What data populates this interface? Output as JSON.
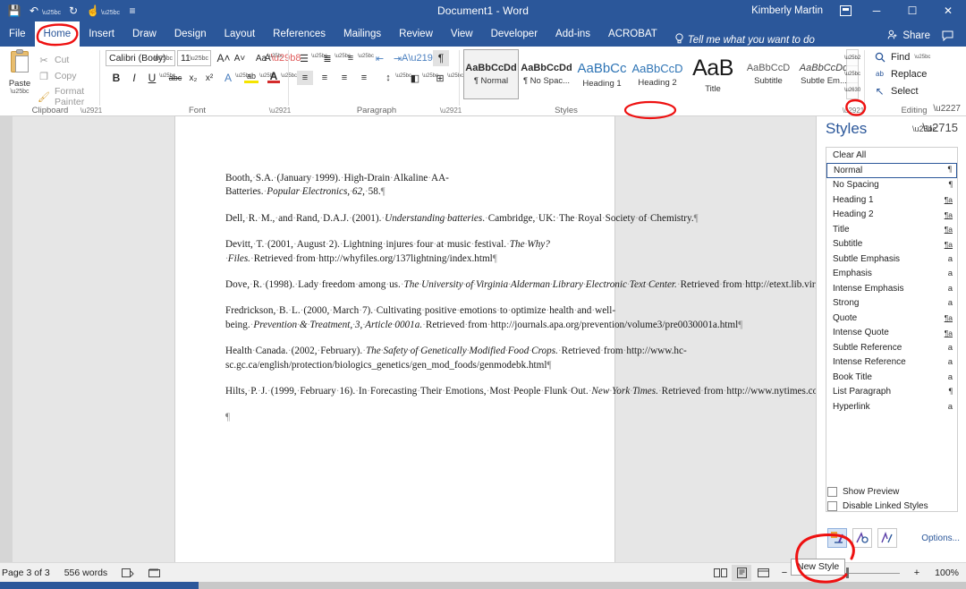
{
  "window": {
    "title": "Document1  -  Word",
    "account": "Kimberly Martin",
    "ribbon_display_icon": "ribbon-display-options-icon",
    "minimize": "─",
    "maximize": "☐",
    "close": "✕"
  },
  "quick_access": [
    {
      "name": "save",
      "glyph": "💾"
    },
    {
      "name": "undo",
      "glyph": "↶"
    },
    {
      "name": "redo",
      "glyph": "↻"
    },
    {
      "name": "touch-mode",
      "glyph": "☝"
    },
    {
      "name": "customize-quick-access-toolbar",
      "glyph": "≡"
    }
  ],
  "tabs": [
    {
      "label": "File",
      "active": false
    },
    {
      "label": "Home",
      "active": true
    },
    {
      "label": "Insert",
      "active": false
    },
    {
      "label": "Draw",
      "active": false
    },
    {
      "label": "Design",
      "active": false
    },
    {
      "label": "Layout",
      "active": false
    },
    {
      "label": "References",
      "active": false
    },
    {
      "label": "Mailings",
      "active": false
    },
    {
      "label": "Review",
      "active": false
    },
    {
      "label": "View",
      "active": false
    },
    {
      "label": "Developer",
      "active": false
    },
    {
      "label": "Add-ins",
      "active": false
    },
    {
      "label": "ACROBAT",
      "active": false
    }
  ],
  "tell_me": {
    "label": "Tell me what you want to do",
    "icon": "lightbulb-icon"
  },
  "share": {
    "label": "Share",
    "icon": "person-share-icon"
  },
  "comments_icon": "comments-icon",
  "ribbon": {
    "clipboard": {
      "label": "Clipboard",
      "paste": "Paste",
      "items": [
        {
          "label": "Cut",
          "icon": "scissors-icon",
          "glyph": "✂"
        },
        {
          "label": "Copy",
          "icon": "copy-icon",
          "glyph": "❐"
        },
        {
          "label": "Format Painter",
          "icon": "format-painter-icon",
          "glyph": "🖌"
        }
      ]
    },
    "font": {
      "label": "Font",
      "font_name": "Calibri (Body)",
      "font_size": "11",
      "row1": [
        {
          "name": "grow-font-icon",
          "glyph": "A˄"
        },
        {
          "name": "shrink-font-icon",
          "glyph": "A˅"
        },
        {
          "name": "change-case-icon",
          "glyph": "Aa"
        },
        {
          "name": "clear-formatting-icon",
          "glyph": "A⌨"
        }
      ],
      "row2": [
        {
          "name": "bold-icon",
          "glyph": "B"
        },
        {
          "name": "italic-icon",
          "glyph": "I"
        },
        {
          "name": "underline-icon",
          "glyph": "U"
        },
        {
          "name": "strikethrough-icon",
          "glyph": "abc"
        },
        {
          "name": "subscript-icon",
          "glyph": "x₂"
        },
        {
          "name": "superscript-icon",
          "glyph": "x²"
        },
        {
          "name": "text-effects-icon",
          "glyph": "A"
        },
        {
          "name": "text-highlight-color-icon",
          "glyph": "ab"
        },
        {
          "name": "font-color-icon",
          "glyph": "A"
        }
      ]
    },
    "paragraph": {
      "label": "Paragraph",
      "row1": [
        {
          "name": "bullets-icon",
          "glyph": "☰"
        },
        {
          "name": "numbering-icon",
          "glyph": "≣"
        },
        {
          "name": "multilevel-list-icon",
          "glyph": "≡"
        },
        {
          "name": "decrease-indent-icon",
          "glyph": "⇤"
        },
        {
          "name": "increase-indent-icon",
          "glyph": "⇥"
        },
        {
          "name": "sort-icon",
          "glyph": "↕"
        },
        {
          "name": "show-hide-formatting-icon",
          "glyph": "¶"
        }
      ],
      "row2": [
        {
          "name": "align-left-icon",
          "glyph": "≡"
        },
        {
          "name": "align-center-icon",
          "glyph": "≡"
        },
        {
          "name": "align-right-icon",
          "glyph": "≡"
        },
        {
          "name": "justify-icon",
          "glyph": "≡"
        },
        {
          "name": "line-spacing-icon",
          "glyph": "↕"
        },
        {
          "name": "shading-icon",
          "glyph": "◧"
        },
        {
          "name": "borders-icon",
          "glyph": "⊞"
        }
      ]
    },
    "styles": {
      "label": "Styles",
      "gallery": [
        {
          "preview": "AaBbCcDd",
          "label": "¶ Normal",
          "kind": "normal",
          "selected": true
        },
        {
          "preview": "AaBbCcDd",
          "label": "¶ No Spac...",
          "kind": "normal",
          "selected": false
        },
        {
          "preview": "AaBbCc",
          "label": "Heading 1",
          "kind": "heading",
          "selected": false
        },
        {
          "preview": "AaBbCcD",
          "label": "Heading 2",
          "kind": "heading",
          "selected": false
        },
        {
          "preview": "AaB",
          "label": "Title",
          "kind": "title",
          "selected": false
        },
        {
          "preview": "AaBbCcD",
          "label": "Subtitle",
          "kind": "subtitle",
          "selected": false
        },
        {
          "preview": "AaBbCcDd",
          "label": "Subtle Em...",
          "kind": "subtle-em",
          "selected": false
        }
      ]
    },
    "editing": {
      "label": "Editing",
      "items": [
        {
          "label": "Find",
          "icon": "search-icon",
          "glyph": "⚲",
          "caret": true
        },
        {
          "label": "Replace",
          "icon": "replace-icon",
          "glyph": "ab",
          "caret": false
        },
        {
          "label": "Select",
          "icon": "select-icon",
          "glyph": "↖",
          "caret": true
        }
      ]
    },
    "collapse_icon": "collapse-ribbon-icon"
  },
  "document": {
    "paragraphs": [
      "Booth, S.A. (January 1999). High-Drain Alkaline AA-Batteries. <i>Popular Electronics, 62,</i> 58.",
      "Dell, R. M., and Rand, D.A.J. (2001). <i>Understanding batteries</i>. Cambridge, UK: The Royal Society of Chemistry.",
      "Devitt, T. (2001, August 2). Lightning injures four at music festival. <i>The Why? Files.</i> Retrieved from http://whyfiles.org/137lightning/index.html",
      "Dove, R. (1998). Lady freedom among us. <i>The University of Virginia Alderman Library Electronic Text Center.</i> Retrieved from http://etext.lib.virginia.edu/subjects/afam.html",
      "Fredrickson, B. L. (2000, March 7). Cultivating positive emotions to optimize health and well-being. <i>Prevention &amp; Treatment, 3, Article 0001a.</i> Retrieved from http://journals.apa.org/prevention/volume3/pre0030001a.html",
      "Health Canada. (2002, February). <i>The Safety of Genetically Modified Food Crops.</i> Retrieved from http://www.hc-sc.gc.ca/english/protection/biologics_genetics/gen_mod_foods/genmodebk.html",
      "Hilts, P. J. (1999, February 16). In Forecasting Their Emotions, Most People Flunk Out. <i>New York Times.</i> Retrieved from http://www.nytimes.com",
      ""
    ]
  },
  "styles_pane": {
    "title": "Styles",
    "menu_icon": "chevron-down-icon",
    "close_icon": "close-icon",
    "items": [
      {
        "label": "Clear All",
        "mark": "",
        "mark_kind": "none",
        "selected": false
      },
      {
        "label": "Normal",
        "mark": "¶",
        "mark_kind": "paragraph",
        "selected": true
      },
      {
        "label": "No Spacing",
        "mark": "¶",
        "mark_kind": "paragraph",
        "selected": false
      },
      {
        "label": "Heading 1",
        "mark": "¶a",
        "mark_kind": "linked",
        "selected": false
      },
      {
        "label": "Heading 2",
        "mark": "¶a",
        "mark_kind": "linked",
        "selected": false
      },
      {
        "label": "Title",
        "mark": "¶a",
        "mark_kind": "linked",
        "selected": false
      },
      {
        "label": "Subtitle",
        "mark": "¶a",
        "mark_kind": "linked",
        "selected": false
      },
      {
        "label": "Subtle Emphasis",
        "mark": "a",
        "mark_kind": "character",
        "selected": false
      },
      {
        "label": "Emphasis",
        "mark": "a",
        "mark_kind": "character",
        "selected": false
      },
      {
        "label": "Intense Emphasis",
        "mark": "a",
        "mark_kind": "character",
        "selected": false
      },
      {
        "label": "Strong",
        "mark": "a",
        "mark_kind": "character",
        "selected": false
      },
      {
        "label": "Quote",
        "mark": "¶a",
        "mark_kind": "linked",
        "selected": false
      },
      {
        "label": "Intense Quote",
        "mark": "¶a",
        "mark_kind": "linked",
        "selected": false
      },
      {
        "label": "Subtle Reference",
        "mark": "a",
        "mark_kind": "character",
        "selected": false
      },
      {
        "label": "Intense Reference",
        "mark": "a",
        "mark_kind": "character",
        "selected": false
      },
      {
        "label": "Book Title",
        "mark": "a",
        "mark_kind": "character",
        "selected": false
      },
      {
        "label": "List Paragraph",
        "mark": "¶",
        "mark_kind": "paragraph",
        "selected": false
      },
      {
        "label": "Hyperlink",
        "mark": "a",
        "mark_kind": "character",
        "selected": false
      }
    ],
    "show_preview": "Show Preview",
    "disable_linked_styles": "Disable Linked Styles",
    "buttons": [
      {
        "name": "new-style-button",
        "glyph": "✐"
      },
      {
        "name": "style-inspector-button",
        "glyph": "✑"
      },
      {
        "name": "manage-styles-button",
        "glyph": "✎"
      }
    ],
    "options_link": "Options..."
  },
  "tooltip": {
    "text": "New Style"
  },
  "status_bar": {
    "page": "Page 3 of 3",
    "words": "556 words",
    "proofing_icon": "spelling-grammar-check-icon",
    "language_icon": "language-icon",
    "views": [
      {
        "name": "read-mode-view",
        "glyph": "📖",
        "active": false
      },
      {
        "name": "print-layout-view",
        "glyph": "▤",
        "active": true
      },
      {
        "name": "web-layout-view",
        "glyph": "▦",
        "active": false
      }
    ],
    "zoom_out": "−",
    "zoom_in": "+",
    "zoom_level": "100%"
  },
  "annotations": {
    "color": "#ee1111",
    "marks": [
      {
        "name": "home-tab-circle"
      },
      {
        "name": "styles-group-label-circle"
      },
      {
        "name": "styles-dialog-launcher-circle"
      },
      {
        "name": "new-style-button-circle"
      }
    ]
  }
}
